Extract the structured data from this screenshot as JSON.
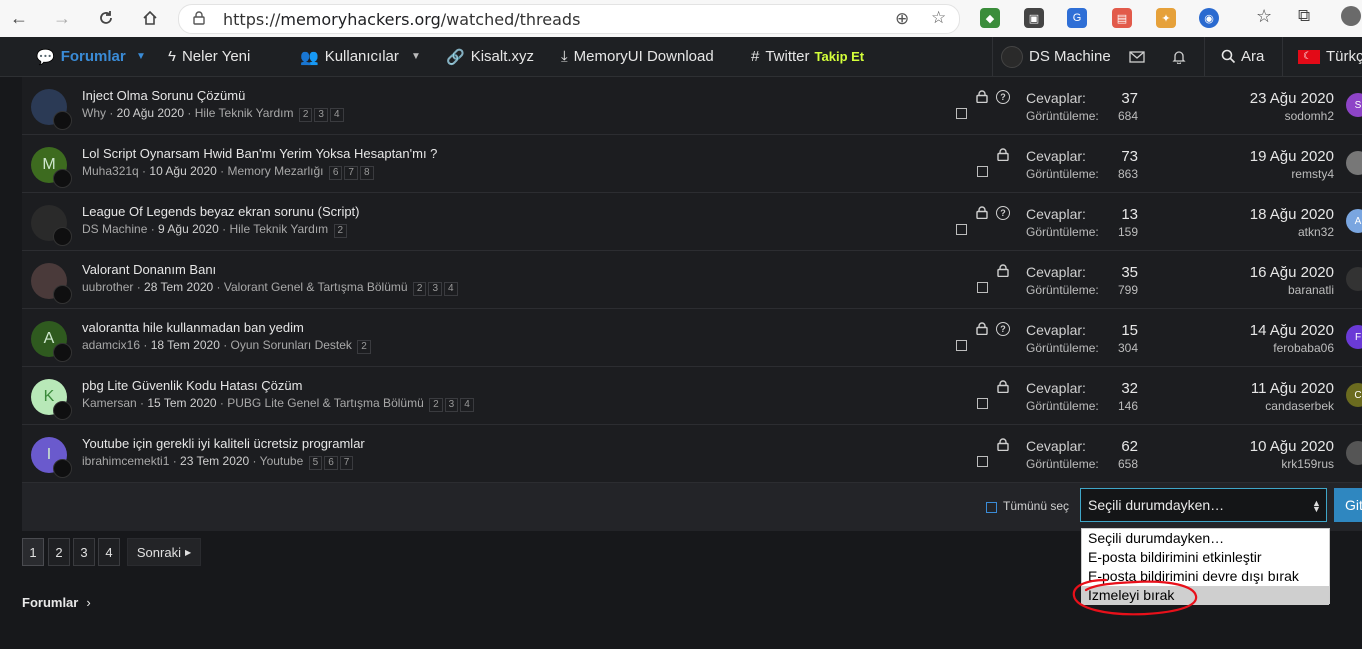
{
  "browser": {
    "url_scheme": "https://",
    "url_host": "memoryhackers.org",
    "url_path": "/watched/threads"
  },
  "nav": {
    "items": [
      {
        "label": "Forumlar"
      },
      {
        "label": "Neler Yeni"
      },
      {
        "label": "Kullanıcılar"
      },
      {
        "label": "Kisalt.xyz"
      },
      {
        "label": "MemoryUI Download"
      },
      {
        "label": "Twitter",
        "badge": "Takip Et"
      }
    ],
    "user": "DS Machine",
    "search": "Ara",
    "language": "Türkç"
  },
  "columns": {
    "replies": "Cevaplar:",
    "views": "Görüntüleme:"
  },
  "threads": [
    {
      "title": "Inject Olma Sorunu Çözümü",
      "author": "Why",
      "date": "20 Ağu 2020",
      "forum": "Hile Teknik Yardım",
      "pages": [
        "2",
        "3",
        "4"
      ],
      "replies": "37",
      "views": "684",
      "last_date": "23 Ağu 2020",
      "last_user": "sodomh2",
      "avatar_letter": "",
      "avatar_color": "#2b3a55",
      "last_avatar": "S",
      "last_avatar_color": "#8e44c7",
      "question": true
    },
    {
      "title": "Lol Script Oynarsam Hwid Ban'mı Yerim Yoksa Hesaptan'mı ?",
      "author": "Muha321q",
      "date": "10 Ağu 2020",
      "forum": "Memory Mezarlığı",
      "pages": [
        "6",
        "7",
        "8"
      ],
      "replies": "73",
      "views": "863",
      "last_date": "19 Ağu 2020",
      "last_user": "remsty4",
      "avatar_letter": "M",
      "avatar_color": "#3d6b1f",
      "last_avatar": "",
      "last_avatar_color": "#777777",
      "question": false
    },
    {
      "title": "League Of Legends beyaz ekran sorunu (Script)",
      "author": "DS Machine",
      "date": "9 Ağu 2020",
      "forum": "Hile Teknik Yardım",
      "pages": [
        "2"
      ],
      "replies": "13",
      "views": "159",
      "last_date": "18 Ağu 2020",
      "last_user": "atkn32",
      "avatar_letter": "",
      "avatar_color": "#2a2a2a",
      "last_avatar": "A",
      "last_avatar_color": "#7aa6e0",
      "question": true
    },
    {
      "title": "Valorant Donanım Banı",
      "author": "uubrother",
      "date": "28 Tem 2020",
      "forum": "Valorant Genel & Tartışma Bölümü",
      "pages": [
        "2",
        "3",
        "4"
      ],
      "replies": "35",
      "views": "799",
      "last_date": "16 Ağu 2020",
      "last_user": "baranatli",
      "avatar_letter": "",
      "avatar_color": "#4a3a3a",
      "last_avatar": "",
      "last_avatar_color": "#333333",
      "question": false
    },
    {
      "title": "valorantta hile kullanmadan ban yedim",
      "author": "adamcix16",
      "date": "18 Tem 2020",
      "forum": "Oyun Sorunları Destek",
      "pages": [
        "2"
      ],
      "replies": "15",
      "views": "304",
      "last_date": "14 Ağu 2020",
      "last_user": "ferobaba06",
      "avatar_letter": "A",
      "avatar_color": "#2f5a1f",
      "last_avatar": "F",
      "last_avatar_color": "#6a3ad6",
      "question": true
    },
    {
      "title": "pbg Lite Güvenlik Kodu Hatası Çözüm",
      "author": "Kamersan",
      "date": "15 Tem 2020",
      "forum": "PUBG Lite Genel & Tartışma Bölümü",
      "pages": [
        "2",
        "3",
        "4"
      ],
      "replies": "32",
      "views": "146",
      "last_date": "11 Ağu 2020",
      "last_user": "candaserbek",
      "avatar_letter": "K",
      "avatar_color": "#b8e8b8",
      "last_avatar": "C",
      "last_avatar_color": "#6b6b1f",
      "question": false
    },
    {
      "title": "Youtube için gerekli iyi kaliteli ücretsiz programlar",
      "author": "ibrahimcemekti1",
      "date": "23 Tem 2020",
      "forum": "Youtube",
      "pages": [
        "5",
        "6",
        "7"
      ],
      "replies": "62",
      "views": "658",
      "last_date": "10 Ağu 2020",
      "last_user": "krk159rus",
      "avatar_letter": "I",
      "avatar_color": "#6a5acd",
      "last_avatar": "",
      "last_avatar_color": "#555555",
      "question": false
    }
  ],
  "footer": {
    "select_all": "Tümünü seç",
    "select_value": "Seçili durumdayken…",
    "go_button": "Git",
    "options": [
      "Seçili durumdayken…",
      "E-posta bildirimini etkinleştir",
      "E-posta bildirimini devre dışı bırak",
      "İzmeleyi bırak"
    ]
  },
  "pagination": {
    "pages": [
      "1",
      "2",
      "3",
      "4"
    ],
    "current": "1",
    "next": "Sonraki"
  },
  "breadcrumb": "Forumlar",
  "colors": {
    "accent": "#3a8bd6",
    "annotation": "#e8101a",
    "background": "#17181b"
  }
}
